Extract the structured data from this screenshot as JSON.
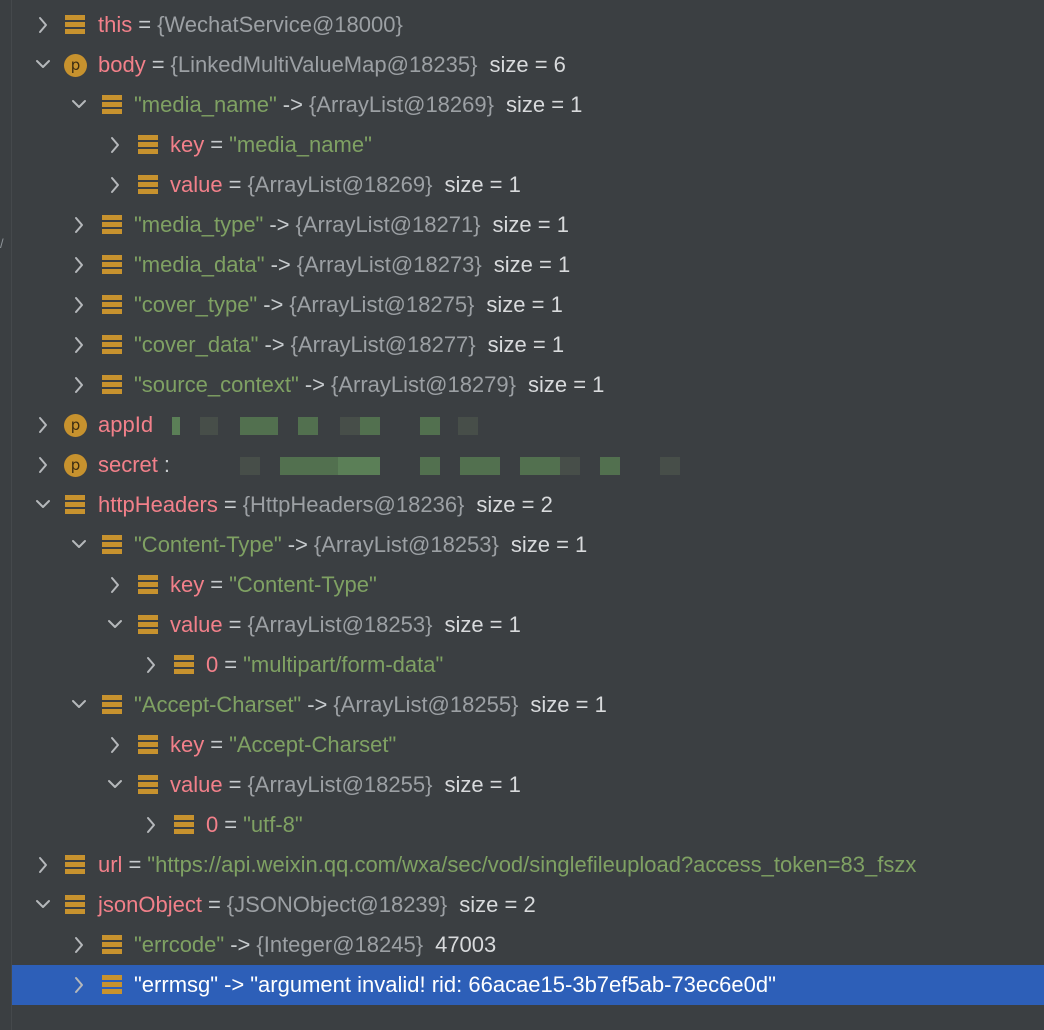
{
  "rows": [
    {
      "name": "this",
      "name_is_string": false,
      "icon": "field",
      "expanded": false,
      "eq": "=",
      "value": "{WechatService@18000}",
      "size": ""
    },
    {
      "name": "body",
      "name_is_string": false,
      "icon": "property",
      "expanded": true,
      "eq": "=",
      "value": "{LinkedMultiValueMap@18235}",
      "size": "size = 6"
    },
    {
      "name": "\"media_name\"",
      "name_is_string": true,
      "icon": "field",
      "expanded": true,
      "eq": "->",
      "value": "{ArrayList@18269}",
      "size": "size = 1"
    },
    {
      "name": "key",
      "name_is_string": false,
      "icon": "field",
      "expanded": false,
      "eq": "=",
      "value": "\"media_name\"",
      "size": ""
    },
    {
      "name": "value",
      "name_is_string": false,
      "icon": "field",
      "expanded": false,
      "eq": "=",
      "value": "{ArrayList@18269}",
      "size": "size = 1"
    },
    {
      "name": "\"media_type\"",
      "name_is_string": true,
      "icon": "field",
      "expanded": false,
      "eq": "->",
      "value": "{ArrayList@18271}",
      "size": "size = 1"
    },
    {
      "name": "\"media_data\"",
      "name_is_string": true,
      "icon": "field",
      "expanded": false,
      "eq": "->",
      "value": "{ArrayList@18273}",
      "size": "size = 1"
    },
    {
      "name": "\"cover_type\"",
      "name_is_string": true,
      "icon": "field",
      "expanded": false,
      "eq": "->",
      "value": "{ArrayList@18275}",
      "size": "size = 1"
    },
    {
      "name": "\"cover_data\"",
      "name_is_string": true,
      "icon": "field",
      "expanded": false,
      "eq": "->",
      "value": "{ArrayList@18277}",
      "size": "size = 1"
    },
    {
      "name": "\"source_context\"",
      "name_is_string": true,
      "icon": "field",
      "expanded": false,
      "eq": "->",
      "value": "{ArrayList@18279}",
      "size": "size = 1"
    },
    {
      "name": "appId",
      "name_is_string": false,
      "icon": "property",
      "expanded": false,
      "eq": "",
      "value": "",
      "size": ""
    },
    {
      "name": "secret",
      "name_is_string": false,
      "icon": "property",
      "expanded": false,
      "eq": ":",
      "value": "",
      "size": ""
    },
    {
      "name": "httpHeaders",
      "name_is_string": false,
      "icon": "field",
      "expanded": true,
      "eq": "=",
      "value": "{HttpHeaders@18236}",
      "size": "size = 2"
    },
    {
      "name": "\"Content-Type\"",
      "name_is_string": true,
      "icon": "field",
      "expanded": true,
      "eq": "->",
      "value": "{ArrayList@18253}",
      "size": "size = 1"
    },
    {
      "name": "key",
      "name_is_string": false,
      "icon": "field",
      "expanded": false,
      "eq": "=",
      "value": "\"Content-Type\"",
      "size": ""
    },
    {
      "name": "value",
      "name_is_string": false,
      "icon": "field",
      "expanded": true,
      "eq": "=",
      "value": "{ArrayList@18253}",
      "size": "size = 1"
    },
    {
      "name": "0",
      "name_is_string": false,
      "icon": "field",
      "expanded": false,
      "eq": "=",
      "value": "\"multipart/form-data\"",
      "size": ""
    },
    {
      "name": "\"Accept-Charset\"",
      "name_is_string": true,
      "icon": "field",
      "expanded": true,
      "eq": "->",
      "value": "{ArrayList@18255}",
      "size": "size = 1"
    },
    {
      "name": "key",
      "name_is_string": false,
      "icon": "field",
      "expanded": false,
      "eq": "=",
      "value": "\"Accept-Charset\"",
      "size": ""
    },
    {
      "name": "value",
      "name_is_string": false,
      "icon": "field",
      "expanded": true,
      "eq": "=",
      "value": "{ArrayList@18255}",
      "size": "size = 1"
    },
    {
      "name": "0",
      "name_is_string": false,
      "icon": "field",
      "expanded": false,
      "eq": "=",
      "value": "\"utf-8\"",
      "size": ""
    },
    {
      "name": "url",
      "name_is_string": false,
      "icon": "field",
      "expanded": false,
      "eq": "=",
      "value": "\"https://api.weixin.qq.com/wxa/sec/vod/singlefileupload?access_token=83_fszx",
      "size": ""
    },
    {
      "name": "jsonObject",
      "name_is_string": false,
      "icon": "field",
      "expanded": true,
      "eq": "=",
      "value": "{JSONObject@18239}",
      "size": "size = 2"
    },
    {
      "name": "\"errcode\"",
      "name_is_string": true,
      "icon": "field",
      "expanded": false,
      "eq": "->",
      "value": "{Integer@18245}",
      "size": "47003"
    },
    {
      "name": "\"errmsg\"",
      "name_is_string": true,
      "icon": "field",
      "expanded": false,
      "eq": "->",
      "value": "\"argument invalid! rid: 66acae15-3b7ef5ab-73ec6e0d\"",
      "size": "",
      "selected": true
    }
  ],
  "colors": {
    "background": "#3b3f42",
    "selection": "#2d5fb8",
    "variable_name": "#f2808a",
    "string_literal": "#7fa163",
    "object_ref": "#9ca0a4",
    "field_icon": "#c7922e",
    "property_icon": "#c7922e"
  }
}
